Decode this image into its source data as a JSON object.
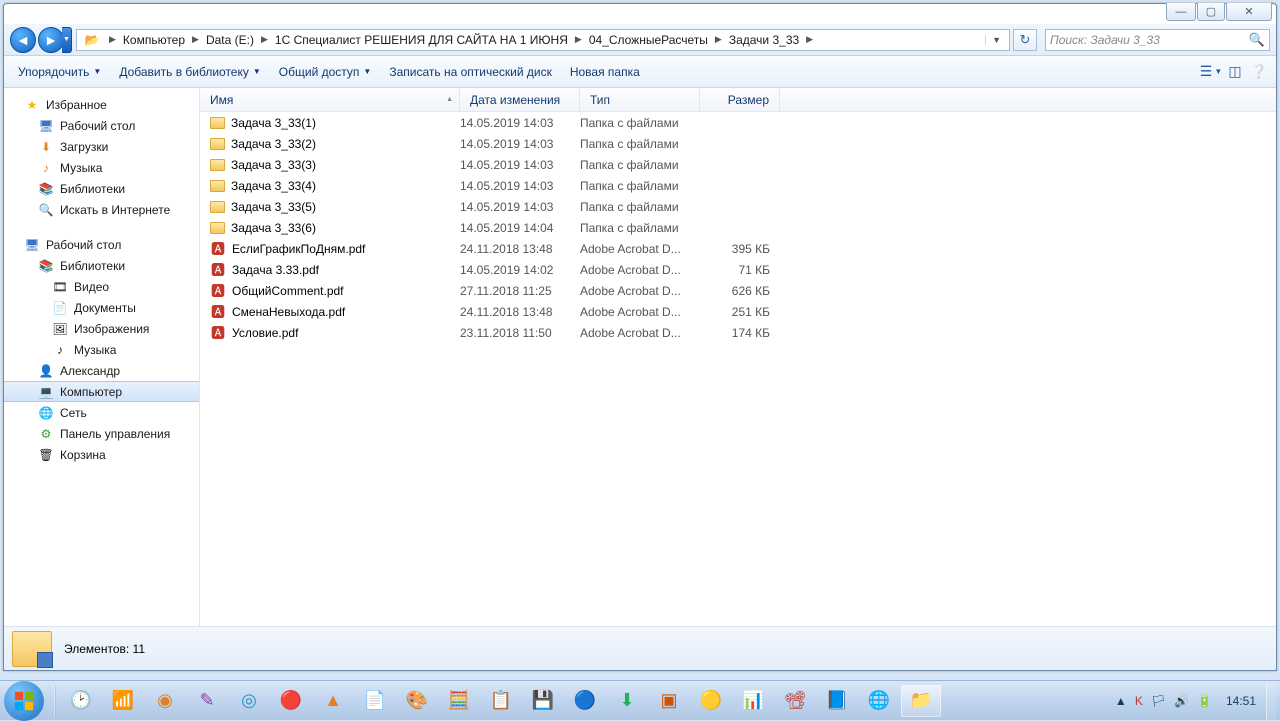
{
  "breadcrumb": [
    "Компьютер",
    "Data (E:)",
    "1С Специалист РЕШЕНИЯ ДЛЯ САЙТА НА 1 ИЮНЯ",
    "04_СложныеРасчеты",
    "Задачи 3_33"
  ],
  "search": {
    "placeholder": "Поиск: Задачи 3_33"
  },
  "toolbar": {
    "organize": "Упорядочить",
    "addlib": "Добавить в библиотеку",
    "share": "Общий доступ",
    "burn": "Записать на оптический диск",
    "newfolder": "Новая папка"
  },
  "cols": {
    "name": "Имя",
    "date": "Дата изменения",
    "type": "Тип",
    "size": "Размер"
  },
  "nav": {
    "fav": "Избранное",
    "desktop": "Рабочий стол",
    "downloads": "Загрузки",
    "music": "Музыка",
    "libraries": "Библиотеки",
    "inet": "Искать в Интернете",
    "desktop2": "Рабочий стол",
    "libraries2": "Библиотеки",
    "video": "Видео",
    "docs": "Документы",
    "pics": "Изображения",
    "music2": "Музыка",
    "user": "Александр",
    "computer": "Компьютер",
    "network": "Сеть",
    "cpanel": "Панель управления",
    "recycle": "Корзина"
  },
  "files": [
    {
      "icon": "folder",
      "name": "Задача 3_33(1)",
      "date": "14.05.2019 14:03",
      "type": "Папка с файлами",
      "size": ""
    },
    {
      "icon": "folder",
      "name": "Задача 3_33(2)",
      "date": "14.05.2019 14:03",
      "type": "Папка с файлами",
      "size": ""
    },
    {
      "icon": "folder",
      "name": "Задача 3_33(3)",
      "date": "14.05.2019 14:03",
      "type": "Папка с файлами",
      "size": ""
    },
    {
      "icon": "folder",
      "name": "Задача 3_33(4)",
      "date": "14.05.2019 14:03",
      "type": "Папка с файлами",
      "size": ""
    },
    {
      "icon": "folder",
      "name": "Задача 3_33(5)",
      "date": "14.05.2019 14:03",
      "type": "Папка с файлами",
      "size": ""
    },
    {
      "icon": "folder",
      "name": "Задача 3_33(6)",
      "date": "14.05.2019 14:04",
      "type": "Папка с файлами",
      "size": ""
    },
    {
      "icon": "pdf",
      "name": "ЕслиГрафикПоДням.pdf",
      "date": "24.11.2018 13:48",
      "type": "Adobe Acrobat D...",
      "size": "395 КБ"
    },
    {
      "icon": "pdf",
      "name": "Задача 3.33.pdf",
      "date": "14.05.2019 14:02",
      "type": "Adobe Acrobat D...",
      "size": "71 КБ"
    },
    {
      "icon": "pdf",
      "name": "ОбщийComment.pdf",
      "date": "27.11.2018 11:25",
      "type": "Adobe Acrobat D...",
      "size": "626 КБ"
    },
    {
      "icon": "pdf",
      "name": "СменаНевыхода.pdf",
      "date": "24.11.2018 13:48",
      "type": "Adobe Acrobat D...",
      "size": "251 КБ"
    },
    {
      "icon": "pdf",
      "name": "Условие.pdf",
      "date": "23.11.2018 11:50",
      "type": "Adobe Acrobat D...",
      "size": "174 КБ"
    }
  ],
  "status": {
    "count": "Элементов: 11"
  },
  "clock": "14:51"
}
